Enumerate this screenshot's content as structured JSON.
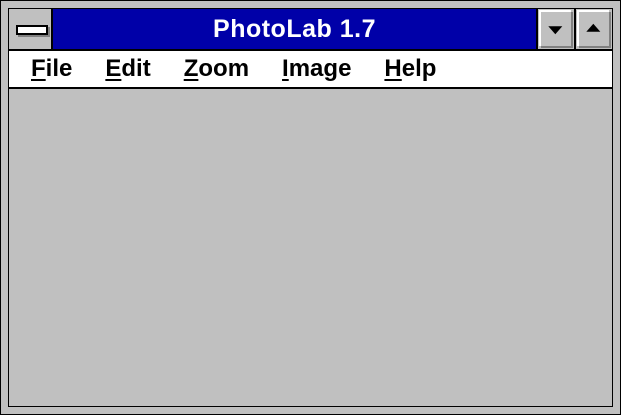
{
  "window": {
    "title": "PhotoLab 1.7",
    "colors": {
      "titlebar": "#0000a8",
      "title_text": "#ffffff",
      "face": "#c0c0c0",
      "menubar": "#ffffff"
    }
  },
  "titlebar": {
    "system_menu_icon": "system-menu-bar-icon",
    "minimize_icon": "triangle-down-icon",
    "maximize_icon": "triangle-up-icon"
  },
  "menubar": {
    "items": [
      {
        "accel": "F",
        "rest": "ile"
      },
      {
        "accel": "E",
        "rest": "dit"
      },
      {
        "accel": "Z",
        "rest": "oom"
      },
      {
        "accel": "I",
        "rest": "mage"
      },
      {
        "accel": "H",
        "rest": "elp"
      }
    ]
  }
}
